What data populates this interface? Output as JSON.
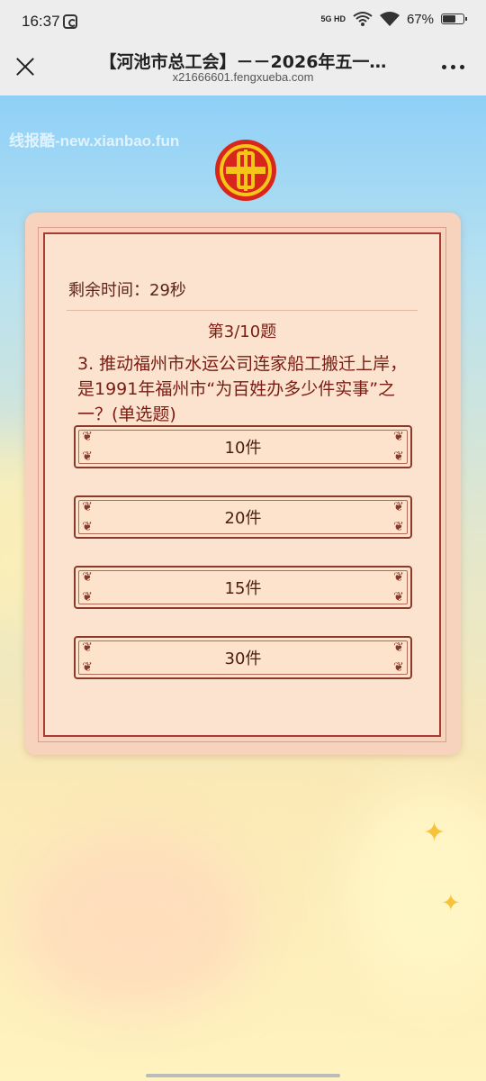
{
  "status_bar": {
    "time": "16:37",
    "network": "5G HD",
    "battery_percent": "67%",
    "battery_level": 0.67
  },
  "nav": {
    "title": "【河池市总工会】－－2026年五一…",
    "subtitle": "x21666601.fengxueba.com",
    "close_icon": "close-icon",
    "more_icon": "more-icon"
  },
  "page": {
    "watermark": "线报酷-new.xianbao.fun",
    "timer": "剩余时间：29秒",
    "question_index": "第3/10题",
    "question_text": "3. 推动福州市水运公司连家船工搬迁上岸，是1991年福州市“为百姓办多少件实事”之一？(单选题)",
    "options": [
      {
        "label": "10件"
      },
      {
        "label": "20件"
      },
      {
        "label": "15件"
      },
      {
        "label": "30件"
      }
    ]
  },
  "colors": {
    "accent": "#a83b32",
    "card_bg": "#fbe3cf",
    "emblem_red": "#d8261c",
    "emblem_gold": "#f5c518"
  }
}
